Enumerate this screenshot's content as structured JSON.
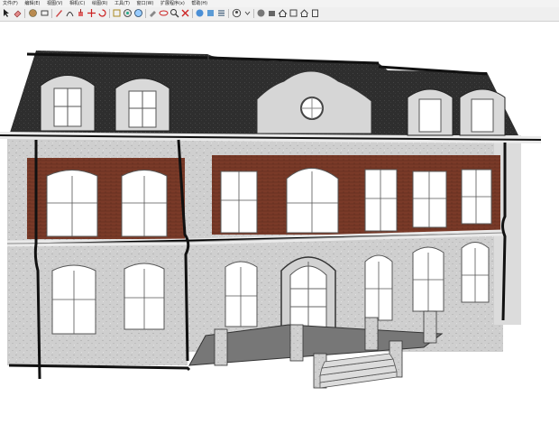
{
  "menubar": {
    "items": [
      "文件(F)",
      "编辑(E)",
      "视图(V)",
      "相机(C)",
      "绘图(R)",
      "工具(T)",
      "窗口(W)",
      "扩展程序(x)",
      "帮助(H)"
    ]
  },
  "toolbar": {
    "tools": [
      "select-arrow-icon",
      "eraser-icon",
      "paint-bucket-icon",
      "rectangle-icon",
      "line-pencil-icon",
      "arc-icon",
      "push-pull-icon",
      "move-icon",
      "rotate-icon",
      "offset-icon",
      "tape-measure-icon",
      "text-icon",
      "paint-icon",
      "orbit-icon",
      "pan-icon",
      "zoom-icon",
      "zoom-extents-icon",
      "section-plane-icon",
      "iso-view-icon",
      "top-view-icon",
      "front-view-icon",
      "account-icon",
      "warehouse-icon",
      "extension-icon",
      "home-icon",
      "door-icon",
      "house-icon"
    ]
  },
  "colors": {
    "roof": "#2f2f2f",
    "stone": "#cfcfcf",
    "brick": "#7a3a28",
    "window_glass": "#ffffff",
    "outline": "#111111"
  }
}
